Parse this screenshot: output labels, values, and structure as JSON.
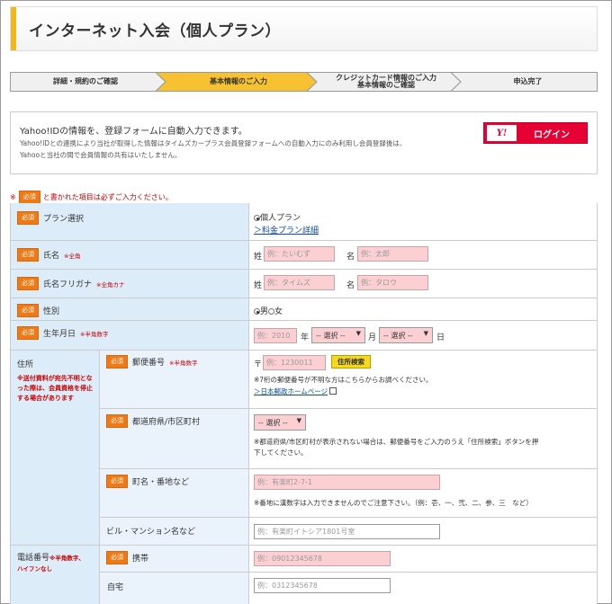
{
  "page": {
    "title": "インターネット入会（個人プラン）"
  },
  "steps": [
    {
      "label": "詳細・規約のご確認",
      "active": false
    },
    {
      "label": "基本情報のご入力",
      "active": true
    },
    {
      "line1": "クレジットカード情報のご入力",
      "line2": "基本情報のご確認",
      "active": false
    },
    {
      "label": "申込完了",
      "active": false
    }
  ],
  "yahoo": {
    "lead": "Yahoo!IDの情報を、登録フォームに自動入力できます。",
    "sub_line1": "Yahoo!IDとの連携により当社が取得した情報はタイムズカープラス会員登録フォームへの自動入力にのみ利用し会員登録後は、",
    "sub_line2": "Yahooと当社の間で会員情報の共有はいたしません。",
    "logo_text": "Y!",
    "login_label": "ログイン"
  },
  "required_badge": "必須",
  "required_note": "と書かれた項目は必ずご入力ください。",
  "form": {
    "plan": {
      "label": "プラン選択",
      "option": "個人プラン",
      "link": "＞料金プラン詳細"
    },
    "name": {
      "label": "氏名",
      "hint": "※全角",
      "sei": "姓",
      "mei": "名",
      "sei_placeholder": "例：たいむず",
      "mei_placeholder": "例：太郎"
    },
    "kana": {
      "label": "氏名フリガナ",
      "hint": "※全角カナ",
      "sei": "姓",
      "mei": "名",
      "sei_placeholder": "例：タイムズ",
      "mei_placeholder": "例：タロウ"
    },
    "gender": {
      "label": "性別",
      "male": "男",
      "female": "女"
    },
    "birth": {
      "label": "生年月日",
      "hint": "※半角数字",
      "year_placeholder": "例：2010",
      "year_unit": "年",
      "month_select": "-- 選択 --",
      "month_unit": "月",
      "day_select": "-- 選択 --",
      "day_unit": "日"
    },
    "address": {
      "label": "住所",
      "warning": "※送付資料が宛先不明となった際は、会員資格を停止する場合があります",
      "zip": {
        "label": "郵便番号",
        "hint": "※半角数字",
        "mark": "〒",
        "placeholder": "例：1230011",
        "button": "住所検索",
        "note": "※7桁の郵便番号が不明な方はこちらからお調べください。",
        "link": "＞日本郵政ホームページ"
      },
      "pref": {
        "label": "都道府県/市区町村",
        "select": "-- 選択 --",
        "note_line1": "※都道府県/市区町村が表示されない場合は、郵便番号をご入力のうえ「住所検索」ボタンを押",
        "note_line2": "下してください。"
      },
      "street": {
        "label": "町名・番地など",
        "placeholder": "例：有楽町2-7-1",
        "note": "※番地に漢数字は入力できませんのでご注意下さい。（例：壱、一、弐、二、参、三　など）"
      },
      "building": {
        "label": "ビル・マンション名など",
        "placeholder": "例：有楽町イトシア1801号室"
      }
    },
    "phone": {
      "label": "電話番号",
      "hint_line1": "※半角数字、",
      "hint_line2": "ハイフンなし",
      "mobile": {
        "label": "携帯",
        "placeholder": "例：09012345678"
      },
      "home": {
        "label": "自宅",
        "placeholder": "例：0312345678"
      }
    }
  },
  "colors": {
    "accent": "#f2b81b",
    "required": "#ee7a15",
    "input_required": "#fcd0d3",
    "label_bg": "#dcecf8",
    "yahoo_red": "#e60033"
  }
}
